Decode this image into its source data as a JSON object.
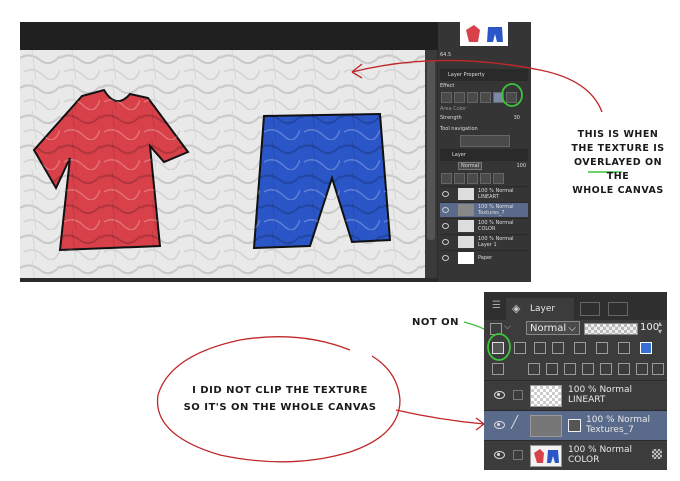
{
  "top_screenshot": {
    "layer_property_title": "Layer Property",
    "effect_label": "Effect",
    "expression_color_label": "Area Color",
    "strength_label": "Strength",
    "strength_value": "30",
    "tool_navigation_label": "Tool navigation",
    "layer_tab": "Layer",
    "blend_mode": "Normal",
    "opacity": "100",
    "size_value": "64.5",
    "layers": [
      {
        "opacity_mode": "100 % Normal",
        "name": "LINEART"
      },
      {
        "opacity_mode": "100 % Normal",
        "name": "Textures_7"
      },
      {
        "opacity_mode": "100 % Normal",
        "name": "COLOR"
      },
      {
        "opacity_mode": "100 % Normal",
        "name": "Layer 1"
      },
      {
        "opacity_mode": "",
        "name": "Paper"
      }
    ]
  },
  "annotations": {
    "overlay_note_lines": [
      "THIS IS WHEN",
      "THE TEXTURE IS",
      "OVERLAYED ON THE",
      "WHOLE CANVAS"
    ],
    "not_on": "NOT ON",
    "clip_note_lines": [
      "I DID NOT CLIP THE TEXTURE",
      "SO IT'S ON THE WHOLE CANVAS"
    ]
  },
  "layer_panel": {
    "tab_label": "Layer",
    "blend_mode": "Normal",
    "opacity": "100",
    "layers": [
      {
        "opacity_mode": "100 % Normal",
        "name": "LINEART",
        "selected": false
      },
      {
        "opacity_mode": "100 % Normal",
        "name": "Textures_7",
        "selected": true
      },
      {
        "opacity_mode": "100 % Normal",
        "name": "COLOR",
        "selected": false
      }
    ]
  },
  "colors": {
    "shirt": "#d9414a",
    "shorts": "#2b56c8",
    "annotation_red": "#c0282a",
    "highlight_green": "#3cc43c",
    "panel_bg": "#3c3c3c"
  }
}
